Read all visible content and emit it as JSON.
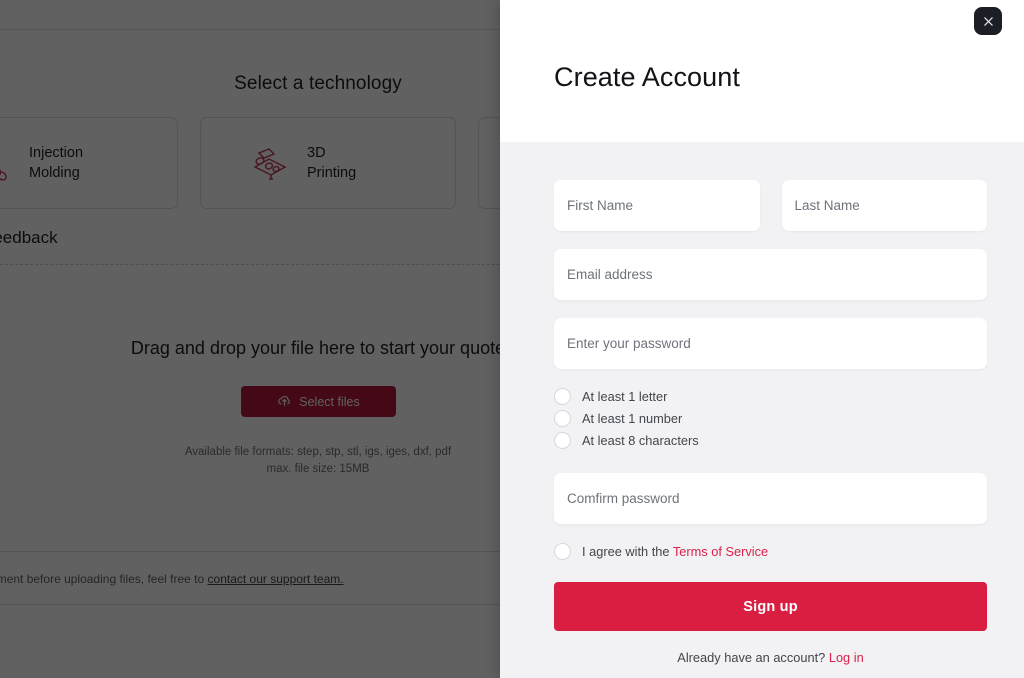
{
  "background": {
    "tech_section_title": "Select a technology",
    "tech_cards": [
      {
        "label_line1": "Injection",
        "label_line2": "Molding",
        "icon": "injection-molding-icon"
      },
      {
        "label_line1": "3D",
        "label_line2": "Printing",
        "icon": "3d-printing-icon"
      },
      {
        "label_line1": "",
        "label_line2": "",
        "icon": "cnc-machining-icon"
      }
    ],
    "section_subtitle": "and DFM feedback",
    "drop_text": "Drag and drop your file here to start your quote",
    "select_files_label": "Select files",
    "select_files_icon": "cloud-upload-icon",
    "formats_line1": "Available file formats: step, stp, stl, igs, iges, dxf, pdf",
    "formats_line2": "max. file size: 15MB",
    "nda_text": "NDA agreement before uploading files, feel free to",
    "nda_link": "contact our support team."
  },
  "panel": {
    "title": "Create Account",
    "close_icon": "close-icon",
    "fields": {
      "first_name_placeholder": "First Name",
      "last_name_placeholder": "Last Name",
      "email_placeholder": "Email address",
      "password_placeholder": "Enter your password",
      "confirm_password_placeholder": "Comfirm password"
    },
    "password_requirements": [
      "At least 1 letter",
      "At least 1 number",
      "At least 8 characters"
    ],
    "terms": {
      "prefix": "I agree with the",
      "link": "Terms of Service"
    },
    "signup_label": "Sign up",
    "login_prompt": "Already have an account?",
    "login_link": "Log in"
  },
  "colors": {
    "brand_red": "#d91e41",
    "link_red": "#d9214a",
    "select_files_red": "#b3173a",
    "panel_bg": "#f2f2f5",
    "close_dark": "#1b1e24"
  }
}
